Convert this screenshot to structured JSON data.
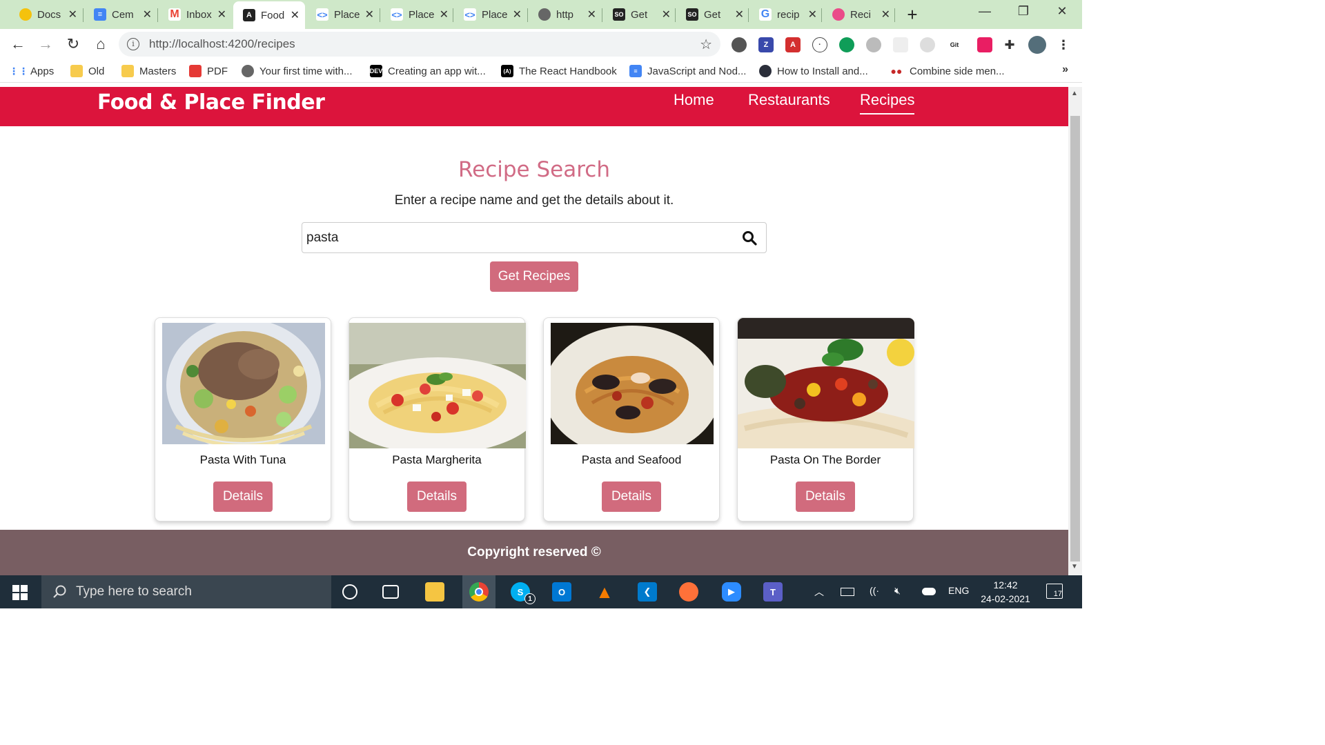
{
  "browser": {
    "tabs": [
      {
        "title": "Docs",
        "favicon": "docs-favicon-icon",
        "color": "#f4c20d"
      },
      {
        "title": "Cem",
        "favicon": "google-docs-icon",
        "color": "#4285f4"
      },
      {
        "title": "Inbox",
        "favicon": "gmail-icon",
        "color": "#ea4335"
      },
      {
        "title": "Food",
        "favicon": "angular-icon",
        "color": "#222222",
        "active": true
      },
      {
        "title": "Place",
        "favicon": "code-icon",
        "color": "#4285f4"
      },
      {
        "title": "Place",
        "favicon": "code-icon",
        "color": "#4285f4"
      },
      {
        "title": "Place",
        "favicon": "code-icon",
        "color": "#4285f4"
      },
      {
        "title": "http",
        "favicon": "globe-icon",
        "color": "#666666"
      },
      {
        "title": "Get",
        "favicon": "stackoverflow-icon",
        "color": "#222222"
      },
      {
        "title": "Get",
        "favicon": "stackoverflow-icon",
        "color": "#222222"
      },
      {
        "title": "recip",
        "favicon": "google-icon",
        "color": "#4285f4"
      },
      {
        "title": "Reci",
        "favicon": "dribbble-icon",
        "color": "#ea4c89"
      }
    ],
    "url": "http://localhost:4200/recipes",
    "bookmarks": [
      {
        "label": "Apps",
        "icon": "apps-grid-icon",
        "color": "#4285f4"
      },
      {
        "label": "Old",
        "icon": "folder-icon",
        "color": "#f7cb4d"
      },
      {
        "label": "Masters",
        "icon": "folder-icon",
        "color": "#f7cb4d"
      },
      {
        "label": "PDF",
        "icon": "pdf-icon",
        "color": "#e53935"
      },
      {
        "label": "Your first time with...",
        "icon": "person-icon",
        "color": "#666666"
      },
      {
        "label": "Creating an app wit...",
        "icon": "dev-icon",
        "color": "#000000",
        "glyph": "DEV"
      },
      {
        "label": "The React Handbook",
        "icon": "react-icon",
        "color": "#000000",
        "glyph": "(A)"
      },
      {
        "label": "JavaScript and Nod...",
        "icon": "google-docs-icon",
        "color": "#4285f4"
      },
      {
        "label": "How to Install and...",
        "icon": "electron-icon",
        "color": "#2b2e3a"
      },
      {
        "label": "Combine side men...",
        "icon": "red-dots-icon",
        "color": "#c62828"
      }
    ]
  },
  "page": {
    "brand": "Food & Place Finder",
    "nav": [
      {
        "label": "Home",
        "active": false
      },
      {
        "label": "Restaurants",
        "active": false
      },
      {
        "label": "Recipes",
        "active": true
      }
    ],
    "title": "Recipe Search",
    "subtitle": "Enter a recipe name and get the details about it.",
    "search": {
      "value": "pasta"
    },
    "get_button": "Get Recipes",
    "recipes": [
      {
        "name": "Pasta With Tuna",
        "button": "Details"
      },
      {
        "name": "Pasta Margherita",
        "button": "Details"
      },
      {
        "name": "Pasta and Seafood",
        "button": "Details"
      },
      {
        "name": "Pasta On The Border",
        "button": "Details"
      }
    ],
    "footer": "Copyright reserved ©",
    "colors": {
      "navbar": "#dc143c",
      "accent": "#d16b7d",
      "footer": "#785e62"
    }
  },
  "taskbar": {
    "search_placeholder": "Type here to search",
    "language": "ENG",
    "time": "12:42",
    "date": "24-02-2021",
    "notifications": "17",
    "skype_badge": "1"
  }
}
